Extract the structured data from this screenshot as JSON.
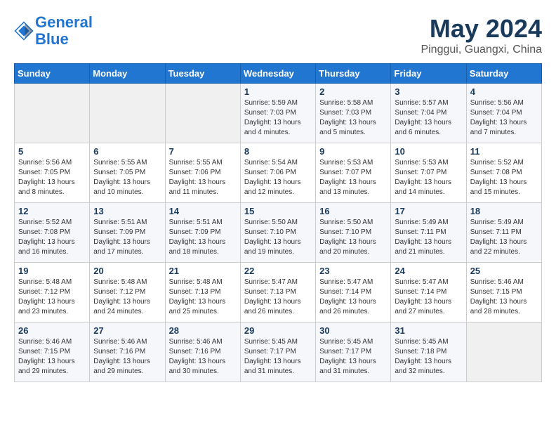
{
  "header": {
    "logo_line1": "General",
    "logo_line2": "Blue",
    "title": "May 2024",
    "subtitle": "Pinggui, Guangxi, China"
  },
  "weekdays": [
    "Sunday",
    "Monday",
    "Tuesday",
    "Wednesday",
    "Thursday",
    "Friday",
    "Saturday"
  ],
  "weeks": [
    [
      {
        "day": "",
        "info": ""
      },
      {
        "day": "",
        "info": ""
      },
      {
        "day": "",
        "info": ""
      },
      {
        "day": "1",
        "info": "Sunrise: 5:59 AM\nSunset: 7:03 PM\nDaylight: 13 hours\nand 4 minutes."
      },
      {
        "day": "2",
        "info": "Sunrise: 5:58 AM\nSunset: 7:03 PM\nDaylight: 13 hours\nand 5 minutes."
      },
      {
        "day": "3",
        "info": "Sunrise: 5:57 AM\nSunset: 7:04 PM\nDaylight: 13 hours\nand 6 minutes."
      },
      {
        "day": "4",
        "info": "Sunrise: 5:56 AM\nSunset: 7:04 PM\nDaylight: 13 hours\nand 7 minutes."
      }
    ],
    [
      {
        "day": "5",
        "info": "Sunrise: 5:56 AM\nSunset: 7:05 PM\nDaylight: 13 hours\nand 8 minutes."
      },
      {
        "day": "6",
        "info": "Sunrise: 5:55 AM\nSunset: 7:05 PM\nDaylight: 13 hours\nand 10 minutes."
      },
      {
        "day": "7",
        "info": "Sunrise: 5:55 AM\nSunset: 7:06 PM\nDaylight: 13 hours\nand 11 minutes."
      },
      {
        "day": "8",
        "info": "Sunrise: 5:54 AM\nSunset: 7:06 PM\nDaylight: 13 hours\nand 12 minutes."
      },
      {
        "day": "9",
        "info": "Sunrise: 5:53 AM\nSunset: 7:07 PM\nDaylight: 13 hours\nand 13 minutes."
      },
      {
        "day": "10",
        "info": "Sunrise: 5:53 AM\nSunset: 7:07 PM\nDaylight: 13 hours\nand 14 minutes."
      },
      {
        "day": "11",
        "info": "Sunrise: 5:52 AM\nSunset: 7:08 PM\nDaylight: 13 hours\nand 15 minutes."
      }
    ],
    [
      {
        "day": "12",
        "info": "Sunrise: 5:52 AM\nSunset: 7:08 PM\nDaylight: 13 hours\nand 16 minutes."
      },
      {
        "day": "13",
        "info": "Sunrise: 5:51 AM\nSunset: 7:09 PM\nDaylight: 13 hours\nand 17 minutes."
      },
      {
        "day": "14",
        "info": "Sunrise: 5:51 AM\nSunset: 7:09 PM\nDaylight: 13 hours\nand 18 minutes."
      },
      {
        "day": "15",
        "info": "Sunrise: 5:50 AM\nSunset: 7:10 PM\nDaylight: 13 hours\nand 19 minutes."
      },
      {
        "day": "16",
        "info": "Sunrise: 5:50 AM\nSunset: 7:10 PM\nDaylight: 13 hours\nand 20 minutes."
      },
      {
        "day": "17",
        "info": "Sunrise: 5:49 AM\nSunset: 7:11 PM\nDaylight: 13 hours\nand 21 minutes."
      },
      {
        "day": "18",
        "info": "Sunrise: 5:49 AM\nSunset: 7:11 PM\nDaylight: 13 hours\nand 22 minutes."
      }
    ],
    [
      {
        "day": "19",
        "info": "Sunrise: 5:48 AM\nSunset: 7:12 PM\nDaylight: 13 hours\nand 23 minutes."
      },
      {
        "day": "20",
        "info": "Sunrise: 5:48 AM\nSunset: 7:12 PM\nDaylight: 13 hours\nand 24 minutes."
      },
      {
        "day": "21",
        "info": "Sunrise: 5:48 AM\nSunset: 7:13 PM\nDaylight: 13 hours\nand 25 minutes."
      },
      {
        "day": "22",
        "info": "Sunrise: 5:47 AM\nSunset: 7:13 PM\nDaylight: 13 hours\nand 26 minutes."
      },
      {
        "day": "23",
        "info": "Sunrise: 5:47 AM\nSunset: 7:14 PM\nDaylight: 13 hours\nand 26 minutes."
      },
      {
        "day": "24",
        "info": "Sunrise: 5:47 AM\nSunset: 7:14 PM\nDaylight: 13 hours\nand 27 minutes."
      },
      {
        "day": "25",
        "info": "Sunrise: 5:46 AM\nSunset: 7:15 PM\nDaylight: 13 hours\nand 28 minutes."
      }
    ],
    [
      {
        "day": "26",
        "info": "Sunrise: 5:46 AM\nSunset: 7:15 PM\nDaylight: 13 hours\nand 29 minutes."
      },
      {
        "day": "27",
        "info": "Sunrise: 5:46 AM\nSunset: 7:16 PM\nDaylight: 13 hours\nand 29 minutes."
      },
      {
        "day": "28",
        "info": "Sunrise: 5:46 AM\nSunset: 7:16 PM\nDaylight: 13 hours\nand 30 minutes."
      },
      {
        "day": "29",
        "info": "Sunrise: 5:45 AM\nSunset: 7:17 PM\nDaylight: 13 hours\nand 31 minutes."
      },
      {
        "day": "30",
        "info": "Sunrise: 5:45 AM\nSunset: 7:17 PM\nDaylight: 13 hours\nand 31 minutes."
      },
      {
        "day": "31",
        "info": "Sunrise: 5:45 AM\nSunset: 7:18 PM\nDaylight: 13 hours\nand 32 minutes."
      },
      {
        "day": "",
        "info": ""
      }
    ]
  ]
}
